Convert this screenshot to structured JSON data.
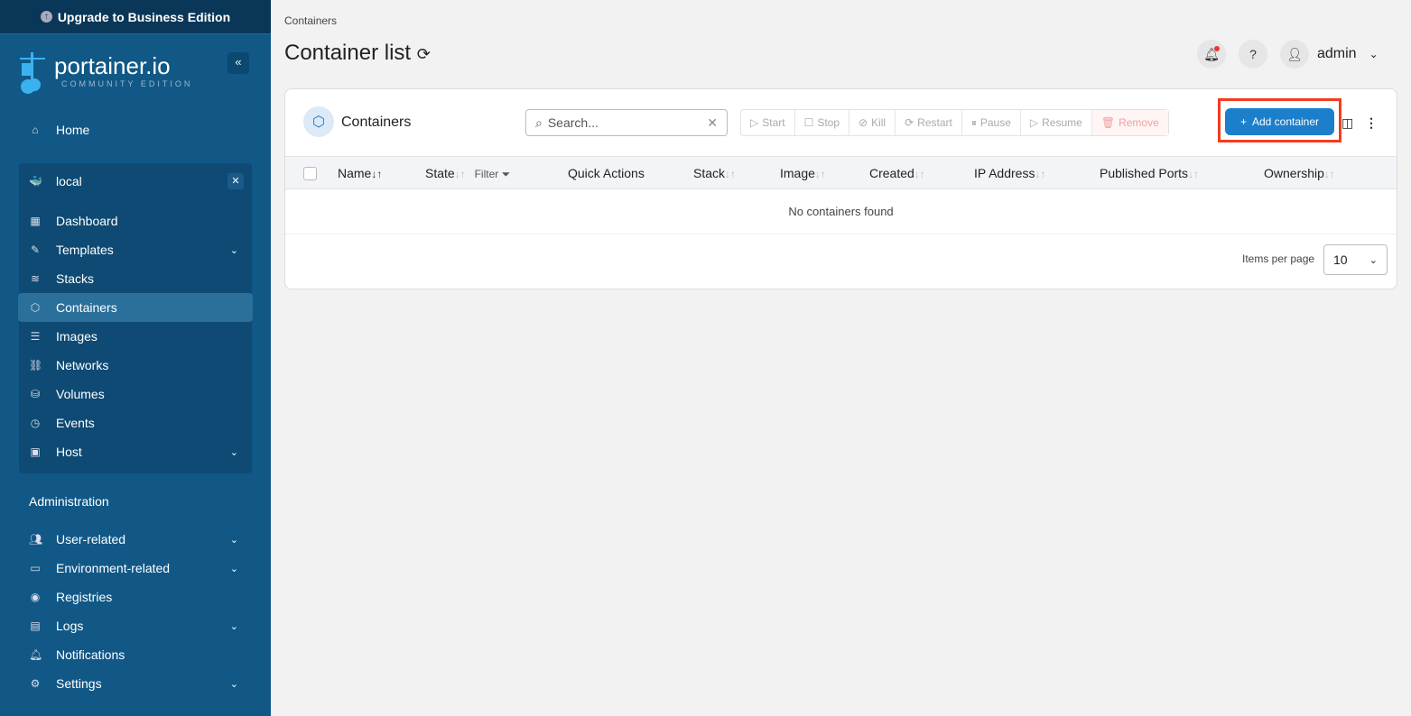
{
  "sidebar": {
    "upgrade": "Upgrade to Business Edition",
    "logo": "portainer.io",
    "logo_sub": "COMMUNITY EDITION",
    "home": "Home",
    "environment": "local",
    "env_items": [
      {
        "label": "Dashboard",
        "icon": "dashboard-icon"
      },
      {
        "label": "Templates",
        "icon": "edit-icon",
        "expand": true
      },
      {
        "label": "Stacks",
        "icon": "layers-icon"
      },
      {
        "label": "Containers",
        "icon": "box-icon",
        "active": true
      },
      {
        "label": "Images",
        "icon": "list-icon"
      },
      {
        "label": "Networks",
        "icon": "network-icon"
      },
      {
        "label": "Volumes",
        "icon": "database-icon"
      },
      {
        "label": "Events",
        "icon": "clock-icon"
      },
      {
        "label": "Host",
        "icon": "host-icon",
        "expand": true
      }
    ],
    "admin_heading": "Administration",
    "admin_items": [
      {
        "label": "User-related",
        "icon": "users-icon",
        "expand": true
      },
      {
        "label": "Environment-related",
        "icon": "drive-icon",
        "expand": true
      },
      {
        "label": "Registries",
        "icon": "radio-icon"
      },
      {
        "label": "Logs",
        "icon": "file-icon",
        "expand": true
      },
      {
        "label": "Notifications",
        "icon": "bell-icon"
      },
      {
        "label": "Settings",
        "icon": "gear-icon",
        "expand": true
      }
    ]
  },
  "header": {
    "breadcrumb": "Containers",
    "title": "Container list",
    "user": "admin"
  },
  "card": {
    "title": "Containers",
    "search_placeholder": "Search...",
    "actions": [
      "Start",
      "Stop",
      "Kill",
      "Restart",
      "Pause",
      "Resume",
      "Remove"
    ],
    "add": "Add container",
    "columns": [
      "Name",
      "State",
      "Quick Actions",
      "Stack",
      "Image",
      "Created",
      "IP Address",
      "Published Ports",
      "Ownership"
    ],
    "filter": "Filter",
    "empty": "No containers found",
    "items_per_page_label": "Items per page",
    "items_per_page": "10"
  },
  "colors": {
    "accent": "#1c7fcb",
    "sidebar": "#115887",
    "highlight": "#f53c1d"
  }
}
